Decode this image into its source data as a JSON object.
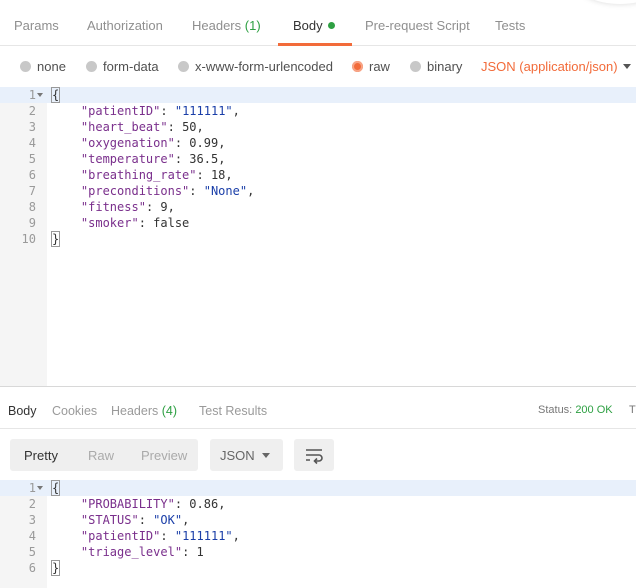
{
  "request": {
    "tabs": [
      {
        "label": "Params"
      },
      {
        "label": "Authorization"
      },
      {
        "label": "Headers",
        "count": "(1)"
      },
      {
        "label": "Body"
      },
      {
        "label": "Pre-request Script"
      },
      {
        "label": "Tests"
      }
    ],
    "body_types": [
      "none",
      "form-data",
      "x-www-form-urlencoded",
      "raw",
      "binary"
    ],
    "selected_body_type": "raw",
    "content_type": "JSON (application/json)",
    "editor_lines": [
      {
        "n": "1",
        "text": "{"
      },
      {
        "n": "2",
        "key": "\"patientID\"",
        "value": "\"111111\"",
        "vtype": "str",
        "comma": ","
      },
      {
        "n": "3",
        "key": "\"heart_beat\"",
        "value": "50",
        "vtype": "num",
        "comma": ","
      },
      {
        "n": "4",
        "key": "\"oxygenation\"",
        "value": "0.99",
        "vtype": "num",
        "comma": ","
      },
      {
        "n": "5",
        "key": "\"temperature\"",
        "value": "36.5",
        "vtype": "num",
        "comma": ","
      },
      {
        "n": "6",
        "key": "\"breathing_rate\"",
        "value": "18",
        "vtype": "num",
        "comma": ","
      },
      {
        "n": "7",
        "key": "\"preconditions\"",
        "value": "\"None\"",
        "vtype": "str",
        "comma": ","
      },
      {
        "n": "8",
        "key": "\"fitness\"",
        "value": "9",
        "vtype": "num",
        "comma": ","
      },
      {
        "n": "9",
        "key": "\"smoker\"",
        "value": "false",
        "vtype": "num",
        "comma": ""
      },
      {
        "n": "10",
        "text": "}"
      }
    ]
  },
  "response": {
    "tabs": [
      {
        "label": "Body"
      },
      {
        "label": "Cookies"
      },
      {
        "label": "Headers",
        "count": "(4)"
      },
      {
        "label": "Test Results"
      }
    ],
    "status_label": "Status:",
    "status_value": "200 OK",
    "status_overflow": "T",
    "view_modes": [
      "Pretty",
      "Raw",
      "Preview"
    ],
    "format": "JSON",
    "editor_lines": [
      {
        "n": "1",
        "text": "{"
      },
      {
        "n": "2",
        "key": "\"PROBABILITY\"",
        "value": "0.86",
        "vtype": "num",
        "comma": ","
      },
      {
        "n": "3",
        "key": "\"STATUS\"",
        "value": "\"OK\"",
        "vtype": "str",
        "comma": ","
      },
      {
        "n": "4",
        "key": "\"patientID\"",
        "value": "\"111111\"",
        "vtype": "str",
        "comma": ","
      },
      {
        "n": "5",
        "key": "\"triage_level\"",
        "value": "1",
        "vtype": "num",
        "comma": ""
      },
      {
        "n": "6",
        "text": "}"
      }
    ]
  },
  "colors": {
    "accent": "#f26b3a",
    "success": "#2ea043",
    "key": "#7a2f8c",
    "string": "#1a3ea8"
  },
  "icons": {
    "wrap": "wrap-lines-icon",
    "caret": "chevron-down-icon"
  }
}
